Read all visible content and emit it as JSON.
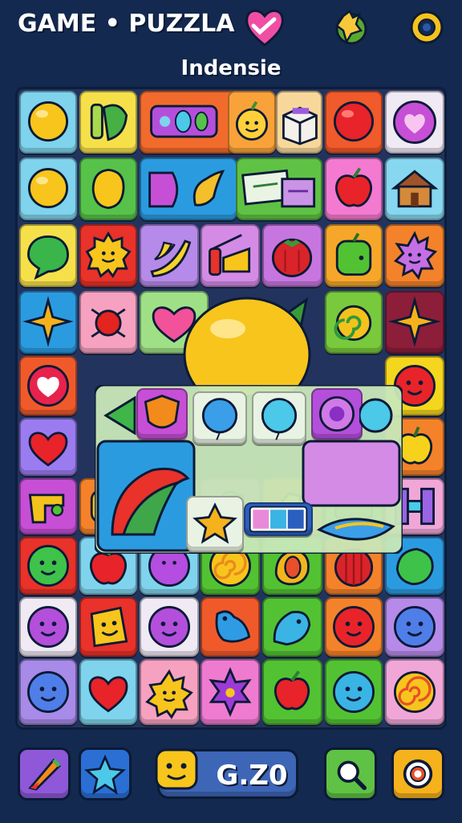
{
  "header": {
    "title": "GAME • PUZZLA",
    "subtitle": "Indensie",
    "icons": [
      "heart-logo-icon",
      "bell-icon",
      "settings-ring-icon"
    ]
  },
  "board": {
    "rows": [
      [
        "yellow-ball",
        "green-leaf-bottles",
        "purple-gem-bar",
        "peach-face",
        "box-gift",
        "red-ball",
        "purple-heart"
      ],
      [
        "yellow-ball",
        "yellow-lemon",
        "purple-shoe",
        "yellow-leaf",
        "green-sign",
        "red-apple",
        "wooden-house"
      ],
      [
        "green-speech-bubble",
        "yellow-sun-face",
        "banana",
        "spray-toy",
        "red-tomato",
        "green-apple",
        "purple-flower"
      ],
      [
        "gold-star",
        "red-bug",
        "pink-heart",
        "yellow-blob",
        "green-leaf",
        "swirl-ball",
        "gold-star"
      ],
      [
        "heart-badge",
        "-",
        "-",
        "-",
        "-",
        "-",
        "red-face"
      ],
      [
        "red-heart",
        "-",
        "-",
        "-",
        "-",
        "-",
        "yellow-apple"
      ],
      [
        "toy-gun",
        "orange-face",
        "green-leaf",
        "blue-bag",
        "yellow-pepper",
        "green-cake",
        "purple-h-block"
      ],
      [
        "green-face",
        "red-apple",
        "purple-ball",
        "orange-swirl",
        "peach-slice",
        "red-melon",
        "green-lemon"
      ],
      [
        "purple-face",
        "yellow-cheese",
        "purple-face",
        "blue-bird",
        "teal-fish",
        "red-face",
        "blue-face"
      ],
      [
        "blue-face",
        "red-heart",
        "yellow-sun",
        "purple-star",
        "red-apple",
        "teal-face",
        "swirl-candy"
      ]
    ]
  },
  "popup": {
    "items": [
      "orange-shield",
      "blue-balloon",
      "blue-balloon",
      "purple-flower-gem",
      "green-leaf-fan",
      "yellow-star",
      "gem-strip",
      "blue-fish-leaf"
    ]
  },
  "bottom": {
    "score": "G.Z0",
    "buttons": [
      "rocket-boost",
      "blue-star",
      "search",
      "settings-ring"
    ]
  },
  "colors": {
    "background": "#13294f",
    "board": "#22345e"
  }
}
